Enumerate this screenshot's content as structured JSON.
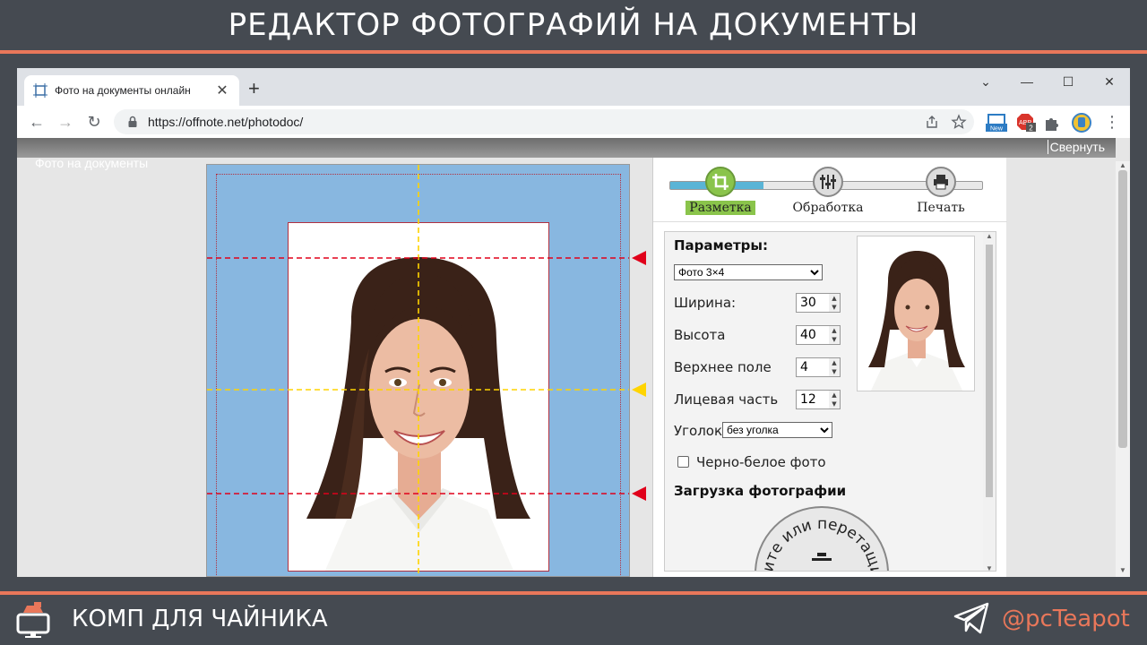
{
  "banner": {
    "title": "РЕДАКТОР ФОТОГРАФИЙ НА ДОКУМЕНТЫ"
  },
  "browser": {
    "tab": {
      "title": "Фото на документы онлайн",
      "close": "✕"
    },
    "new_tab": "+",
    "window_buttons": {
      "menu": "⌄",
      "minimize": "—",
      "maximize": "☐",
      "close": "✕"
    },
    "nav": {
      "back": "←",
      "forward": "→",
      "reload": "↻"
    },
    "url": "https://offnote.net/photodoc/",
    "extensions": {
      "new_badge": "New",
      "abp_count": "2"
    }
  },
  "page": {
    "label": "Фото на документы",
    "collapse_label": "Свернуть"
  },
  "editor": {
    "steps": [
      {
        "label": "Разметка",
        "active": true
      },
      {
        "label": "Обработка",
        "active": false
      },
      {
        "label": "Печать",
        "active": false
      }
    ],
    "progress_fraction": 0.3,
    "params": {
      "heading": "Параметры:",
      "format_selected": "Фото 3×4",
      "width_label": "Ширина:",
      "width_value": "30",
      "height_label": "Высота",
      "height_value": "40",
      "top_margin_label": "Верхнее поле",
      "top_margin_value": "4",
      "face_label": "Лицевая часть",
      "face_value": "12",
      "corner_label": "Уголок",
      "corner_selected": "без уголка",
      "bw_label": "Черно-белое фото",
      "bw_checked": false,
      "upload_heading": "Загрузка фотографии",
      "upload_ring_text": "ите или перетащи"
    }
  },
  "footer": {
    "brand": "КОМП ДЛЯ ЧАЙНИКА",
    "handle": "@pcTeapot"
  },
  "colors": {
    "accent": "#e9775a",
    "background": "#454a51",
    "canvas_bg": "#88b7e0",
    "active_step": "#8ac44b",
    "guide_red": "#e0001a",
    "guide_yellow": "#ffd400"
  }
}
